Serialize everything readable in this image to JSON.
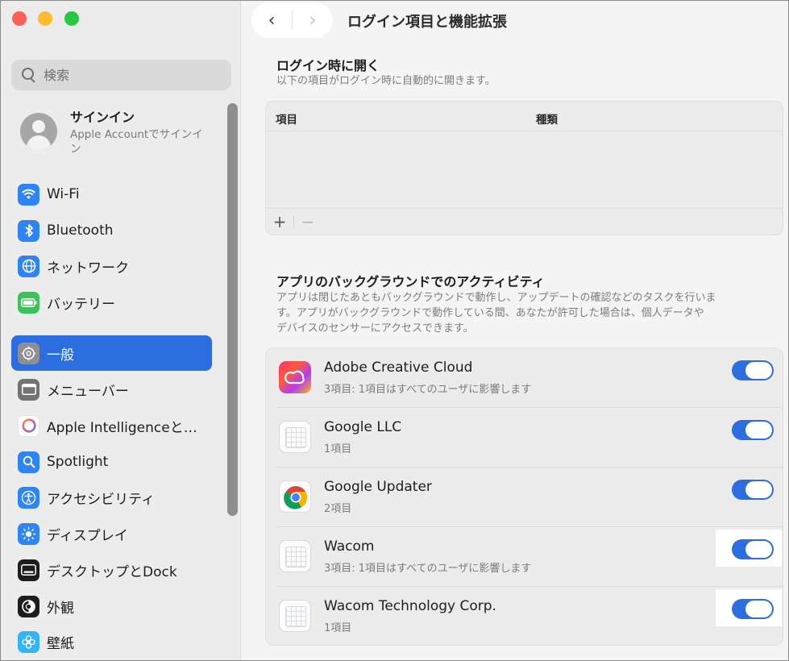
{
  "sidebar": {
    "search_placeholder": "検索",
    "account": {
      "name": "サインイン",
      "subtitle": "Apple Accountでサインイン"
    },
    "items": [
      {
        "label": "Wi-Fi",
        "icon": "wifi-icon",
        "color": "#2f84f3"
      },
      {
        "label": "Bluetooth",
        "icon": "bluetooth-icon",
        "color": "#2f84f3"
      },
      {
        "label": "ネットワーク",
        "icon": "globe-icon",
        "color": "#2f84f3"
      },
      {
        "label": "バッテリー",
        "icon": "battery-icon",
        "color": "#3fc15a"
      },
      {
        "label": "一般",
        "icon": "gear-icon",
        "color": "#8e8e93"
      },
      {
        "label": "メニューバー",
        "icon": "menubar-icon",
        "color": "#737373"
      },
      {
        "label": "Apple Intelligenceと…",
        "icon": "apple-intelligence-icon",
        "color": "#ff8a3d"
      },
      {
        "label": "Spotlight",
        "icon": "spotlight-icon",
        "color": "#2f84f3"
      },
      {
        "label": "アクセシビリティ",
        "icon": "accessibility-icon",
        "color": "#2f84f3"
      },
      {
        "label": "ディスプレイ",
        "icon": "display-icon",
        "color": "#2f84f3"
      },
      {
        "label": "デスクトップとDock",
        "icon": "dock-icon",
        "color": "#1d1d1f"
      },
      {
        "label": "外観",
        "icon": "appearance-icon",
        "color": "#1d1d1f"
      },
      {
        "label": "壁紙",
        "icon": "wallpaper-icon",
        "color": "#33b5f5"
      }
    ],
    "active_index": 4
  },
  "header": {
    "title": "ログイン項目と機能拡張"
  },
  "login_section": {
    "title": "ログイン時に開く",
    "subtitle": "以下の項目がログイン時に自動的に開きます。",
    "col_item": "項目",
    "col_type": "種類",
    "add": "+",
    "remove": "−"
  },
  "background_section": {
    "title": "アプリのバックグラウンドでのアクティビティ",
    "desc_line1": "アプリは閉じたあともバックグラウンドで動作し、アップデートの確認などのタスクを行いま",
    "desc_line2": "す。アプリがバックグラウンドで動作している間、あなたが許可した場合は、個人データや",
    "desc_line3": "デバイスのセンサーにアクセスできます。",
    "apps": [
      {
        "name": "Adobe Creative Cloud",
        "detail": "3項目: 1項目はすべてのユーザに影響します",
        "enabled": true,
        "icon": "adobe-cc-icon"
      },
      {
        "name": "Google LLC",
        "detail": "1項目",
        "enabled": true,
        "icon": "generic-app-icon"
      },
      {
        "name": "Google Updater",
        "detail": "2項目",
        "enabled": true,
        "icon": "chrome-icon"
      },
      {
        "name": "Wacom",
        "detail": "3項目: 1項目はすべてのユーザに影響します",
        "enabled": true,
        "icon": "generic-app-icon"
      },
      {
        "name": "Wacom Technology Corp.",
        "detail": "1項目",
        "enabled": true,
        "icon": "generic-app-icon"
      }
    ]
  },
  "colors": {
    "accent": "#2c6ee0",
    "window_bg": "#f4f4f4",
    "sidebar_bg": "#ececec"
  }
}
